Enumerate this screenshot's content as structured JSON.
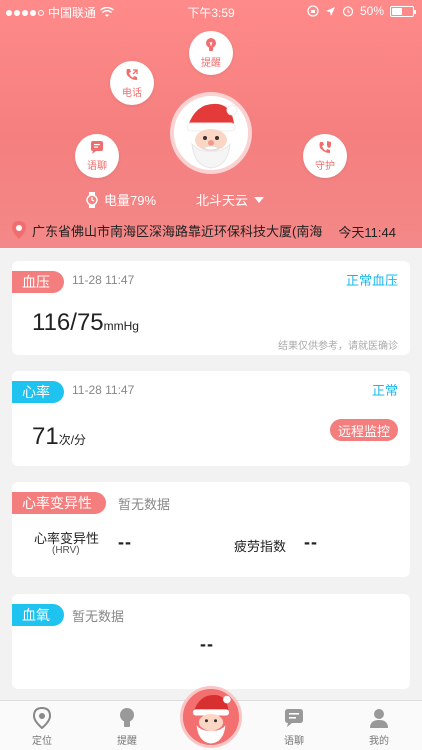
{
  "status_bar": {
    "carrier": "中国联通",
    "time": "下午3:59",
    "battery": "50%",
    "battery_level": 0.5
  },
  "header": {
    "buttons": {
      "call": "电话",
      "remind": "提醒",
      "voice_chat": "语聊",
      "guard": "守护"
    },
    "power_label": "电量79%",
    "device_name": "北斗天云",
    "address": "广东省佛山市南海区深海路靠近环保科技大厦(南海...",
    "address_time": "今天11:44"
  },
  "cards": {
    "blood_pressure": {
      "tag": "血压",
      "time": "11-28 11:47",
      "status": "正常血压",
      "systolic": "116",
      "sep": "/",
      "diastolic": "75",
      "unit": "mmHg",
      "note": "结果仅供参考，请就医确诊"
    },
    "heart_rate": {
      "tag": "心率",
      "time": "11-28 11:47",
      "status": "正常",
      "value": "71",
      "unit": "次/分",
      "button": "远程监控"
    },
    "hrv": {
      "tag": "心率变异性",
      "no_data": "暂无数据",
      "label": "心率变异性",
      "label_sub": "(HRV)",
      "value": "--",
      "fatigue_label": "疲劳指数",
      "fatigue_value": "--"
    },
    "oxygen": {
      "tag": "血氧",
      "no_data": "暂无数据",
      "value": "--"
    }
  },
  "tabbar": {
    "location": "定位",
    "remind": "提醒",
    "voice_chat": "语聊",
    "mine": "我的"
  },
  "colors": {
    "accent_red": "#f47d7d",
    "accent_blue": "#1ec3f0"
  }
}
